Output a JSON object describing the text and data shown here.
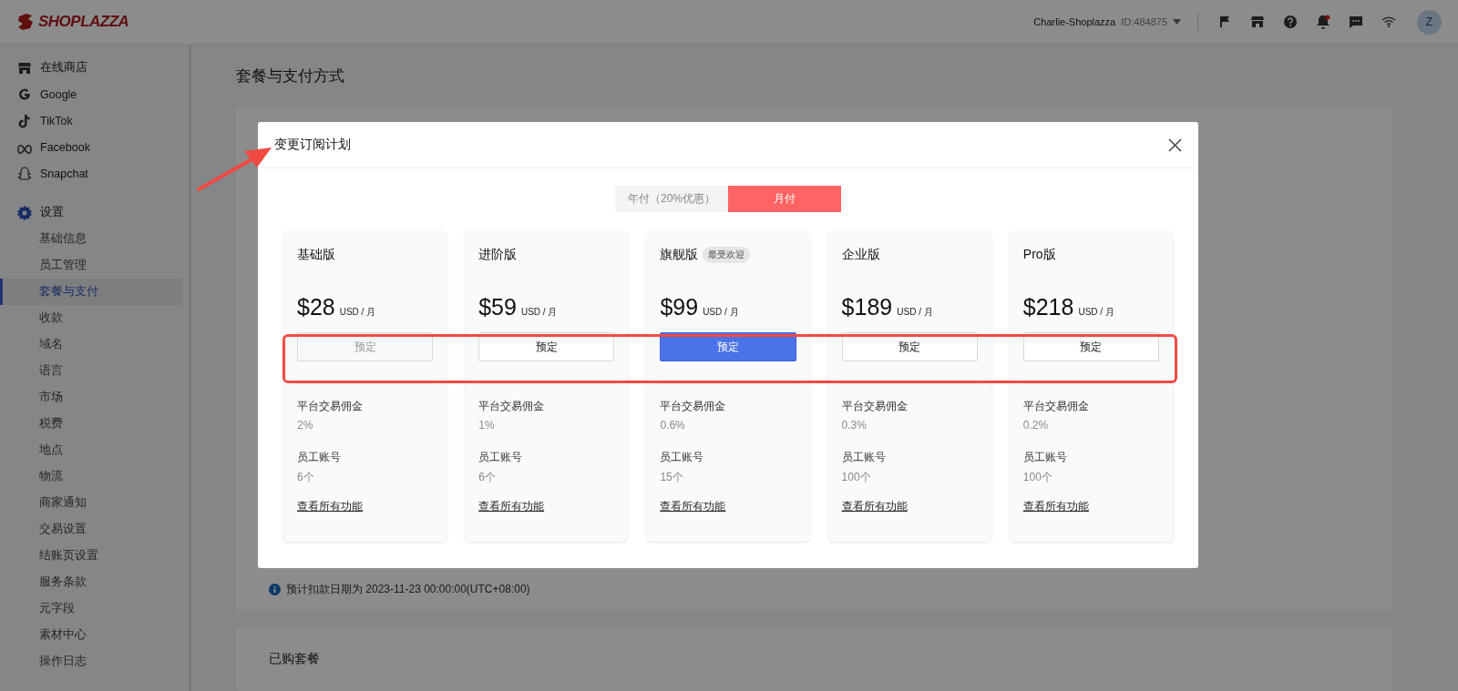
{
  "topbar": {
    "logo": "SHOPLAZZA",
    "account": "Charlie-Shoplazza",
    "account_id": "ID:484875",
    "avatar": "Z",
    "notifications_unread": true
  },
  "sidebar": {
    "items": [
      {
        "label": "在线商店"
      },
      {
        "label": "Google"
      },
      {
        "label": "TikTok"
      },
      {
        "label": "Facebook"
      },
      {
        "label": "Snapchat"
      }
    ],
    "settings": {
      "label": "设置",
      "children": [
        {
          "label": "基础信息",
          "selected": false
        },
        {
          "label": "员工管理",
          "selected": false
        },
        {
          "label": "套餐与支付",
          "selected": true
        },
        {
          "label": "收款",
          "selected": false
        },
        {
          "label": "域名",
          "selected": false
        },
        {
          "label": "语言",
          "selected": false
        },
        {
          "label": "市场",
          "selected": false
        },
        {
          "label": "税费",
          "selected": false
        },
        {
          "label": "地点",
          "selected": false
        },
        {
          "label": "物流",
          "selected": false
        },
        {
          "label": "商家通知",
          "selected": false
        },
        {
          "label": "交易设置",
          "selected": false
        },
        {
          "label": "结账页设置",
          "selected": false
        },
        {
          "label": "服务条款",
          "selected": false
        },
        {
          "label": "元字段",
          "selected": false
        },
        {
          "label": "素材中心",
          "selected": false
        },
        {
          "label": "操作日志",
          "selected": false
        }
      ]
    }
  },
  "page": {
    "title": "套餐与支付方式",
    "billing_note": "预计扣款日期为 2023-11-23 00:00:00(UTC+08:00)",
    "purchased_title": "已购套餐"
  },
  "modal": {
    "title": "变更订阅计划",
    "billing_toggle": [
      {
        "label": "年付（20%优惠）",
        "selected": false
      },
      {
        "label": "月付",
        "selected": true
      }
    ],
    "plans": [
      {
        "name": "基础版",
        "price": "$28",
        "unit": "USD / 月",
        "button": {
          "label": "预定",
          "kind": "disabled"
        },
        "features": [
          {
            "label": "平台交易佣金",
            "value": "2%"
          },
          {
            "label": "员工账号",
            "value": "6个"
          }
        ],
        "link": "查看所有功能"
      },
      {
        "name": "进阶版",
        "price": "$59",
        "unit": "USD / 月",
        "button": {
          "label": "预定",
          "kind": "default"
        },
        "features": [
          {
            "label": "平台交易佣金",
            "value": "1%"
          },
          {
            "label": "员工账号",
            "value": "6个"
          }
        ],
        "link": "查看所有功能"
      },
      {
        "name": "旗舰版",
        "badge": "最受欢迎",
        "price": "$99",
        "unit": "USD / 月",
        "button": {
          "label": "预定",
          "kind": "primary"
        },
        "features": [
          {
            "label": "平台交易佣金",
            "value": "0.6%"
          },
          {
            "label": "员工账号",
            "value": "15个"
          }
        ],
        "link": "查看所有功能"
      },
      {
        "name": "企业版",
        "price": "$189",
        "unit": "USD / 月",
        "button": {
          "label": "预定",
          "kind": "default"
        },
        "features": [
          {
            "label": "平台交易佣金",
            "value": "0.3%"
          },
          {
            "label": "员工账号",
            "value": "100个"
          }
        ],
        "link": "查看所有功能"
      },
      {
        "name": "Pro版",
        "price": "$218",
        "unit": "USD / 月",
        "button": {
          "label": "预定",
          "kind": "default"
        },
        "features": [
          {
            "label": "平台交易佣金",
            "value": "0.2%"
          },
          {
            "label": "员工账号",
            "value": "100个"
          }
        ],
        "link": "查看所有功能"
      }
    ]
  }
}
